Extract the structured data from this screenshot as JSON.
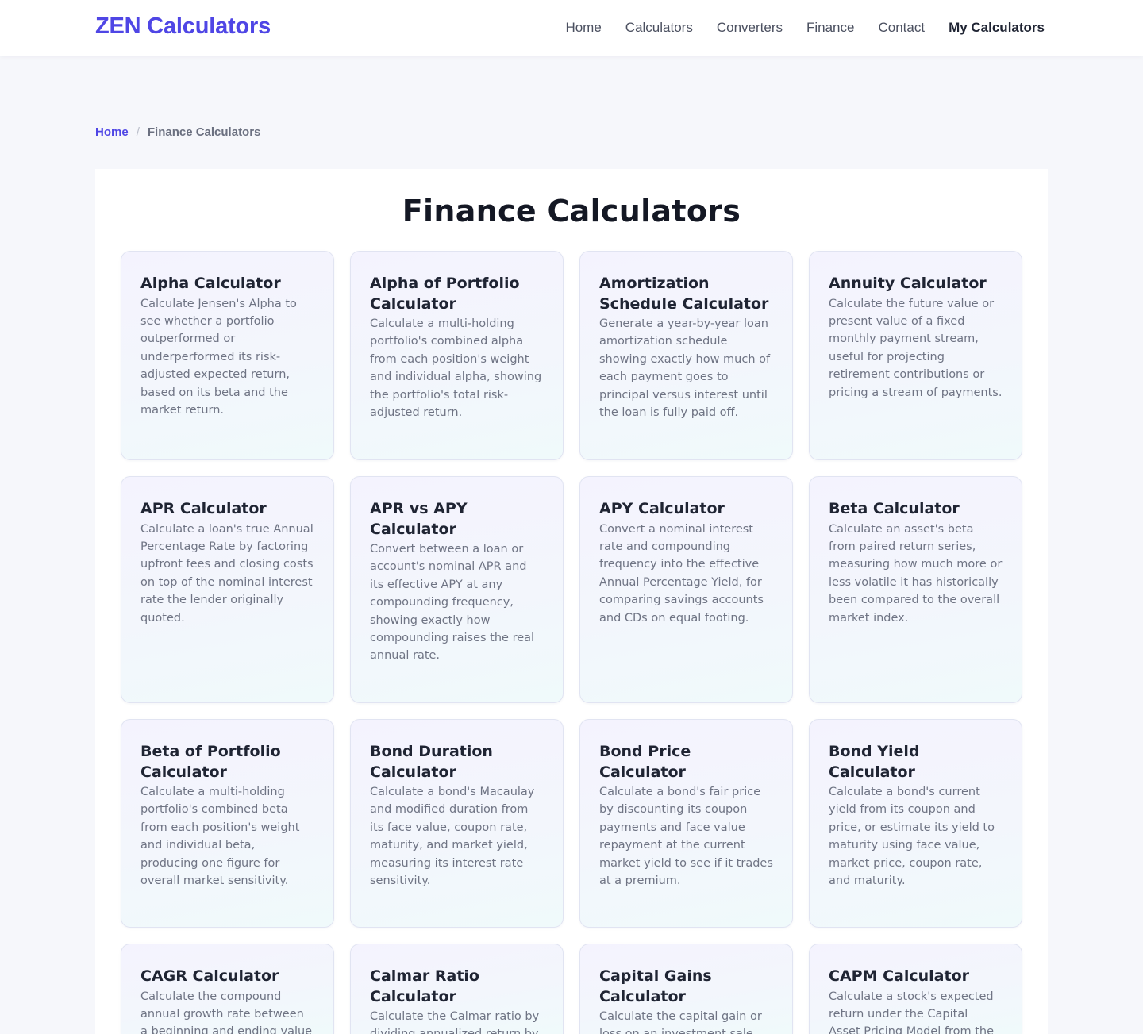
{
  "header": {
    "logo": "ZEN Calculators",
    "nav": [
      {
        "label": "Home"
      },
      {
        "label": "Calculators"
      },
      {
        "label": "Converters"
      },
      {
        "label": "Finance"
      },
      {
        "label": "Contact"
      },
      {
        "label": "My Calculators"
      }
    ]
  },
  "breadcrumb": {
    "home": "Home",
    "separator": "/",
    "current": "Finance Calculators"
  },
  "main": {
    "title": "Finance Calculators",
    "cards": [
      {
        "title": "Alpha Calculator",
        "description": "Calculate Jensen's Alpha to see whether a portfolio outperformed or underperformed its risk-adjusted expected return, based on its beta and the market return."
      },
      {
        "title": "Alpha of Portfolio Calculator",
        "description": "Calculate a multi-holding portfolio's combined alpha from each position's weight and individual alpha, showing the portfolio's total risk-adjusted return."
      },
      {
        "title": "Amortization Schedule Calculator",
        "description": "Generate a year-by-year loan amortization schedule showing exactly how much of each payment goes to principal versus interest until the loan is fully paid off."
      },
      {
        "title": "Annuity Calculator",
        "description": "Calculate the future value or present value of a fixed monthly payment stream, useful for projecting retirement contributions or pricing a stream of payments."
      },
      {
        "title": "APR Calculator",
        "description": "Calculate a loan's true Annual Percentage Rate by factoring upfront fees and closing costs on top of the nominal interest rate the lender originally quoted."
      },
      {
        "title": "APR vs APY Calculator",
        "description": "Convert between a loan or account's nominal APR and its effective APY at any compounding frequency, showing exactly how compounding raises the real annual rate."
      },
      {
        "title": "APY Calculator",
        "description": "Convert a nominal interest rate and compounding frequency into the effective Annual Percentage Yield, for comparing savings accounts and CDs on equal footing."
      },
      {
        "title": "Beta Calculator",
        "description": "Calculate an asset's beta from paired return series, measuring how much more or less volatile it has historically been compared to the overall market index."
      },
      {
        "title": "Beta of Portfolio Calculator",
        "description": "Calculate a multi-holding portfolio's combined beta from each position's weight and individual beta, producing one figure for overall market sensitivity."
      },
      {
        "title": "Bond Duration Calculator",
        "description": "Calculate a bond's Macaulay and modified duration from its face value, coupon rate, maturity, and market yield, measuring its interest rate sensitivity."
      },
      {
        "title": "Bond Price Calculator",
        "description": "Calculate a bond's fair price by discounting its coupon payments and face value repayment at the current market yield to see if it trades at a premium."
      },
      {
        "title": "Bond Yield Calculator",
        "description": "Calculate a bond's current yield from its coupon and price, or estimate its yield to maturity using face value, market price, coupon rate, and maturity."
      },
      {
        "title": "CAGR Calculator",
        "description": "Calculate the compound annual growth rate between a beginning and ending value"
      },
      {
        "title": "Calmar Ratio Calculator",
        "description": "Calculate the Calmar ratio by dividing annualized return by"
      },
      {
        "title": "Capital Gains Calculator",
        "description": "Calculate the capital gain or loss on an investment sale"
      },
      {
        "title": "CAPM Calculator",
        "description": "Calculate a stock's expected return under the Capital Asset Pricing Model from the risk-"
      }
    ]
  }
}
